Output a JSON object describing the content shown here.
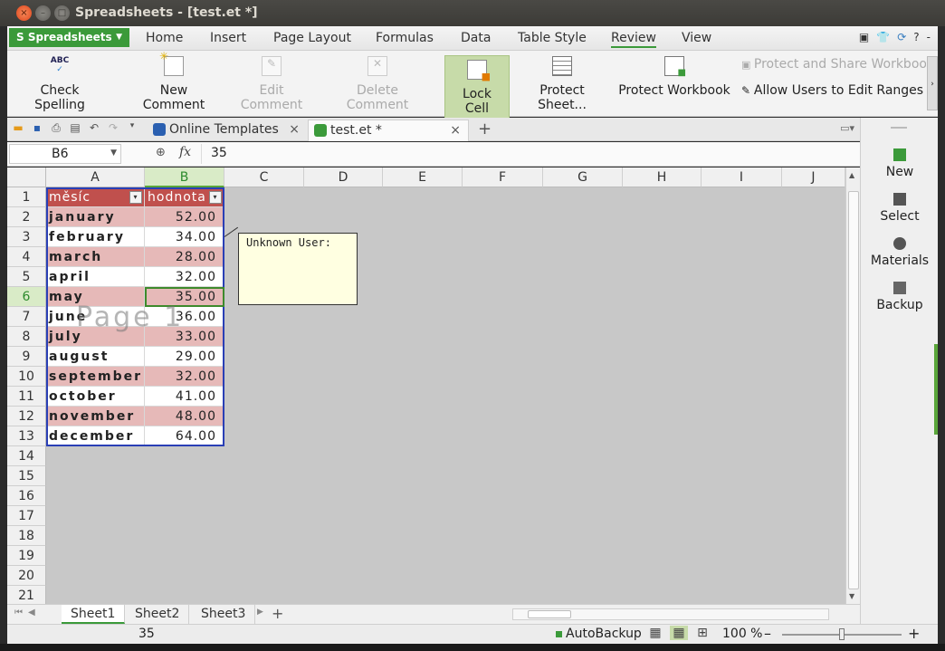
{
  "window": {
    "title": "Spreadsheets - [test.et *]",
    "controls": [
      "×",
      "–",
      "□"
    ]
  },
  "menubar": {
    "app_button": "Spreadsheets",
    "items": [
      "Home",
      "Insert",
      "Page Layout",
      "Formulas",
      "Data",
      "Table Style",
      "Review",
      "View"
    ],
    "active": "Review",
    "right_icons": [
      "▣",
      "👕",
      "⟳",
      "?",
      "-"
    ]
  },
  "ribbon": {
    "check_spelling": "Check Spelling",
    "check_spelling_icon_text": "ABC",
    "new_comment": "New Comment",
    "edit_comment": "Edit Comment",
    "delete_comment": "Delete Comment",
    "lock_cell": "Lock Cell",
    "protect_sheet": "Protect Sheet...",
    "protect_workbook": "Protect Workbook",
    "protect_and_share": "Protect and Share Workbook",
    "allow_users": "Allow Users to Edit Ranges",
    "scroll_arrow": "›"
  },
  "tabbar": {
    "online_templates": "Online Templates",
    "doc_tab": "test.et *",
    "close": "×",
    "add": "+"
  },
  "formulabar": {
    "name_box": "B6",
    "fx": "fx",
    "value": "35"
  },
  "grid": {
    "columns": [
      "A",
      "B",
      "C",
      "D",
      "E",
      "F",
      "G",
      "H",
      "I",
      "J"
    ],
    "rows": [
      "1",
      "2",
      "3",
      "4",
      "5",
      "6",
      "7",
      "8",
      "9",
      "10",
      "11",
      "12",
      "13",
      "14",
      "15",
      "16",
      "17",
      "18",
      "19",
      "20",
      "21"
    ],
    "header": [
      "měsíc",
      "hodnota"
    ],
    "data": [
      {
        "month": "january",
        "value": "52.00"
      },
      {
        "month": "february",
        "value": "34.00"
      },
      {
        "month": "march",
        "value": "28.00"
      },
      {
        "month": "april",
        "value": "32.00"
      },
      {
        "month": "may",
        "value": "35.00"
      },
      {
        "month": "june",
        "value": "36.00"
      },
      {
        "month": "july",
        "value": "33.00"
      },
      {
        "month": "august",
        "value": "29.00"
      },
      {
        "month": "september",
        "value": "32.00"
      },
      {
        "month": "october",
        "value": "41.00"
      },
      {
        "month": "november",
        "value": "48.00"
      },
      {
        "month": "december",
        "value": "64.00"
      }
    ],
    "watermark": "Page 1",
    "comment_text": "Unknown User:",
    "filter_glyph": "▾"
  },
  "sheets": {
    "tabs": [
      "Sheet1",
      "Sheet2",
      "Sheet3"
    ],
    "active": "Sheet1",
    "add": "+"
  },
  "statusbar": {
    "sum": "35",
    "autobackup": "AutoBackup",
    "zoom": "100 %",
    "zoom_minus": "–",
    "zoom_plus": "+",
    "zoom_level": 0.5
  },
  "taskpane": {
    "items": [
      "New",
      "Select",
      "Materials",
      "Backup"
    ]
  },
  "colors": {
    "accent_green": "#3b9a3a",
    "table_header": "#c0504d",
    "row_band": "#e6b9b8",
    "table_frame": "#2a3fb5"
  }
}
